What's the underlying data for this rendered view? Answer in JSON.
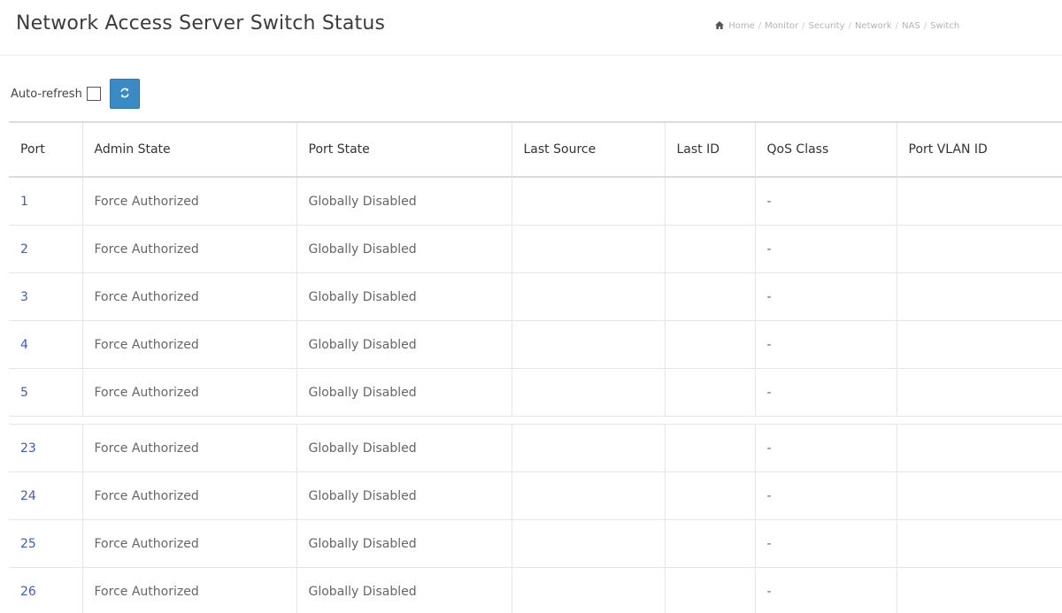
{
  "page": {
    "title": "Network Access Server Switch Status"
  },
  "breadcrumb": {
    "icon": "home-icon",
    "items": [
      "Home",
      "Monitor",
      "Security",
      "Network",
      "NAS",
      "Switch"
    ]
  },
  "toolbar": {
    "auto_refresh_label": "Auto-refresh",
    "auto_refresh_checked": false,
    "refresh_icon": "refresh-icon",
    "refresh_color": "#3a8bc5"
  },
  "table": {
    "columns": [
      "Port",
      "Admin State",
      "Port State",
      "Last Source",
      "Last ID",
      "QoS Class",
      "Port VLAN ID"
    ],
    "rows_top": [
      {
        "port": "1",
        "admin_state": "Force Authorized",
        "port_state": "Globally Disabled",
        "last_source": "",
        "last_id": "",
        "qos_class": "-",
        "port_vlan_id": ""
      },
      {
        "port": "2",
        "admin_state": "Force Authorized",
        "port_state": "Globally Disabled",
        "last_source": "",
        "last_id": "",
        "qos_class": "-",
        "port_vlan_id": ""
      },
      {
        "port": "3",
        "admin_state": "Force Authorized",
        "port_state": "Globally Disabled",
        "last_source": "",
        "last_id": "",
        "qos_class": "-",
        "port_vlan_id": ""
      },
      {
        "port": "4",
        "admin_state": "Force Authorized",
        "port_state": "Globally Disabled",
        "last_source": "",
        "last_id": "",
        "qos_class": "-",
        "port_vlan_id": ""
      },
      {
        "port": "5",
        "admin_state": "Force Authorized",
        "port_state": "Globally Disabled",
        "last_source": "",
        "last_id": "",
        "qos_class": "-",
        "port_vlan_id": ""
      }
    ],
    "rows_bottom": [
      {
        "port": "23",
        "admin_state": "Force Authorized",
        "port_state": "Globally Disabled",
        "last_source": "",
        "last_id": "",
        "qos_class": "-",
        "port_vlan_id": ""
      },
      {
        "port": "24",
        "admin_state": "Force Authorized",
        "port_state": "Globally Disabled",
        "last_source": "",
        "last_id": "",
        "qos_class": "-",
        "port_vlan_id": ""
      },
      {
        "port": "25",
        "admin_state": "Force Authorized",
        "port_state": "Globally Disabled",
        "last_source": "",
        "last_id": "",
        "qos_class": "-",
        "port_vlan_id": ""
      },
      {
        "port": "26",
        "admin_state": "Force Authorized",
        "port_state": "Globally Disabled",
        "last_source": "",
        "last_id": "",
        "qos_class": "-",
        "port_vlan_id": ""
      }
    ],
    "link_color": "#3b5bcf"
  }
}
